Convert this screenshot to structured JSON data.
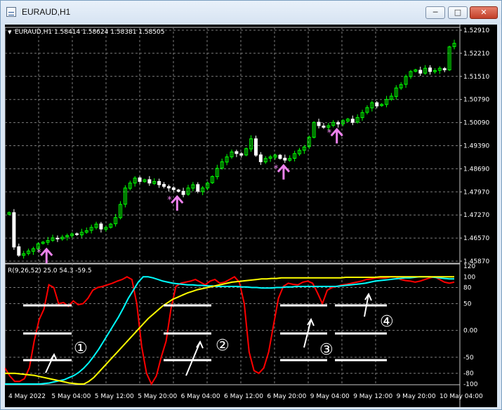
{
  "window": {
    "title": "EURAUD,H1",
    "min_glyph": "─",
    "max_glyph": "□",
    "close_glyph": "✕"
  },
  "main_chart": {
    "info_line": "EURAUD,H1  1.58414 1.58624 1.58381 1.58505",
    "price_labels": [
      "1.52910",
      "1.52210",
      "1.51510",
      "1.50790",
      "1.50090",
      "1.49390",
      "1.48690",
      "1.47970",
      "1.47270",
      "1.46570",
      "1.45870"
    ],
    "bull_color": "#00ff00",
    "bear_color": "#ffffff",
    "signal_color": "#ee82ee"
  },
  "indicator": {
    "info_line": "R(9,26,52) 25.0 54.3 -59.5",
    "scale_labels": [
      "120",
      "100",
      "80",
      "50",
      "0.00",
      "-50",
      "-80",
      "-100"
    ],
    "line_colors": {
      "fast": "#ff0000",
      "medium": "#00ffff",
      "slow": "#ffff00"
    },
    "markers": [
      "①",
      "②",
      "③",
      "④"
    ]
  },
  "time_axis": {
    "labels": [
      "4 May 2022",
      "5 May 04:00",
      "5 May 12:00",
      "5 May 20:00",
      "6 May 04:00",
      "6 May 12:00",
      "6 May 20:00",
      "9 May 04:00",
      "9 May 12:00",
      "9 May 20:00",
      "10 May 04:00"
    ]
  },
  "chart_data": {
    "type": "candlestick",
    "symbol": "EURAUD",
    "timeframe": "H1",
    "price_range": [
      1.4587,
      1.5291
    ],
    "closes": [
      1.4735,
      1.463,
      1.4605,
      1.461,
      1.4618,
      1.4625,
      1.464,
      1.4645,
      1.465,
      1.4658,
      1.4655,
      1.466,
      1.4665,
      1.467,
      1.4668,
      1.4675,
      1.468,
      1.469,
      1.47,
      1.4685,
      1.469,
      1.47,
      1.472,
      1.476,
      1.481,
      1.4825,
      1.484,
      1.483,
      1.4835,
      1.4825,
      1.483,
      1.482,
      1.4815,
      1.481,
      1.4805,
      1.48,
      1.479,
      1.481,
      1.482,
      1.48,
      1.481,
      1.4825,
      1.4845,
      1.487,
      1.489,
      1.4905,
      1.492,
      1.4915,
      1.491,
      1.493,
      1.496,
      1.491,
      1.489,
      1.49,
      1.4905,
      1.491,
      1.49,
      1.4895,
      1.49,
      1.4915,
      1.4925,
      1.4935,
      1.4965,
      1.501,
      1.5,
      1.4995,
      1.5,
      1.501,
      1.5005,
      1.5015,
      1.502,
      1.501,
      1.5025,
      1.504,
      1.5055,
      1.507,
      1.506,
      1.5065,
      1.508,
      1.509,
      1.5115,
      1.5125,
      1.515,
      1.5165,
      1.517,
      1.516,
      1.5175,
      1.5165,
      1.5168,
      1.5175,
      1.517,
      1.524,
      1.5251
    ],
    "signal_arrow_bars": [
      7,
      34,
      56,
      67
    ],
    "indicator_range": [
      -100,
      120
    ],
    "indicator_levels": [
      80,
      50,
      0,
      -50,
      -80
    ],
    "series": [
      {
        "name": "fast",
        "values": [
          -70,
          -85,
          -95,
          -95,
          -90,
          -70,
          -20,
          20,
          40,
          85,
          80,
          50,
          52,
          45,
          55,
          48,
          50,
          60,
          75,
          80,
          82,
          85,
          88,
          92,
          95,
          100,
          95,
          50,
          -30,
          -80,
          -100,
          -85,
          -50,
          -20,
          40,
          82,
          88,
          90,
          92,
          95,
          90,
          85,
          92,
          95,
          88,
          90,
          95,
          100,
          90,
          50,
          -40,
          -75,
          -80,
          -70,
          -40,
          10,
          60,
          82,
          88,
          86,
          85,
          90,
          92,
          88,
          70,
          50,
          75,
          80,
          82,
          85,
          86,
          88,
          90,
          92,
          95,
          96,
          98,
          98,
          98,
          100,
          100,
          95,
          93,
          92,
          90,
          92,
          95,
          98,
          100,
          95,
          90,
          88,
          90
        ]
      },
      {
        "name": "medium",
        "values": [
          -100,
          -100,
          -100,
          -100,
          -100,
          -100,
          -100,
          -100,
          -99,
          -98,
          -96,
          -94,
          -92,
          -88,
          -84,
          -78,
          -70,
          -60,
          -48,
          -35,
          -20,
          -5,
          10,
          25,
          42,
          60,
          75,
          90,
          100,
          100,
          98,
          95,
          92,
          90,
          88,
          87,
          86,
          85,
          85,
          84,
          84,
          83,
          83,
          82,
          82,
          82,
          82,
          82,
          81,
          81,
          80,
          80,
          79,
          79,
          79,
          80,
          80,
          81,
          81,
          82,
          82,
          82,
          82,
          82,
          82,
          82,
          82,
          82,
          83,
          84,
          85,
          86,
          87,
          88,
          90,
          92,
          93,
          94,
          95,
          96,
          97,
          98,
          98,
          99,
          100,
          100,
          100,
          99,
          98,
          97,
          96,
          96
        ]
      },
      {
        "name": "slow",
        "values": [
          -80,
          -80,
          -80,
          -81,
          -82,
          -83,
          -84,
          -86,
          -88,
          -90,
          -92,
          -94,
          -96,
          -98,
          -99,
          -100,
          -100,
          -95,
          -88,
          -78,
          -68,
          -58,
          -48,
          -38,
          -28,
          -18,
          -8,
          2,
          12,
          22,
          30,
          38,
          46,
          52,
          58,
          62,
          66,
          70,
          73,
          76,
          78,
          80,
          82,
          84,
          86,
          88,
          90,
          91,
          92,
          93,
          94,
          95,
          96,
          96,
          97,
          97,
          98,
          98,
          98,
          98,
          98,
          98,
          98,
          98,
          98,
          98,
          98,
          98,
          98,
          99,
          99,
          99,
          99,
          99,
          99,
          99,
          100,
          100,
          100,
          100,
          100,
          100,
          100,
          100,
          100,
          100,
          100,
          100,
          100,
          100,
          100,
          100
        ]
      }
    ]
  }
}
